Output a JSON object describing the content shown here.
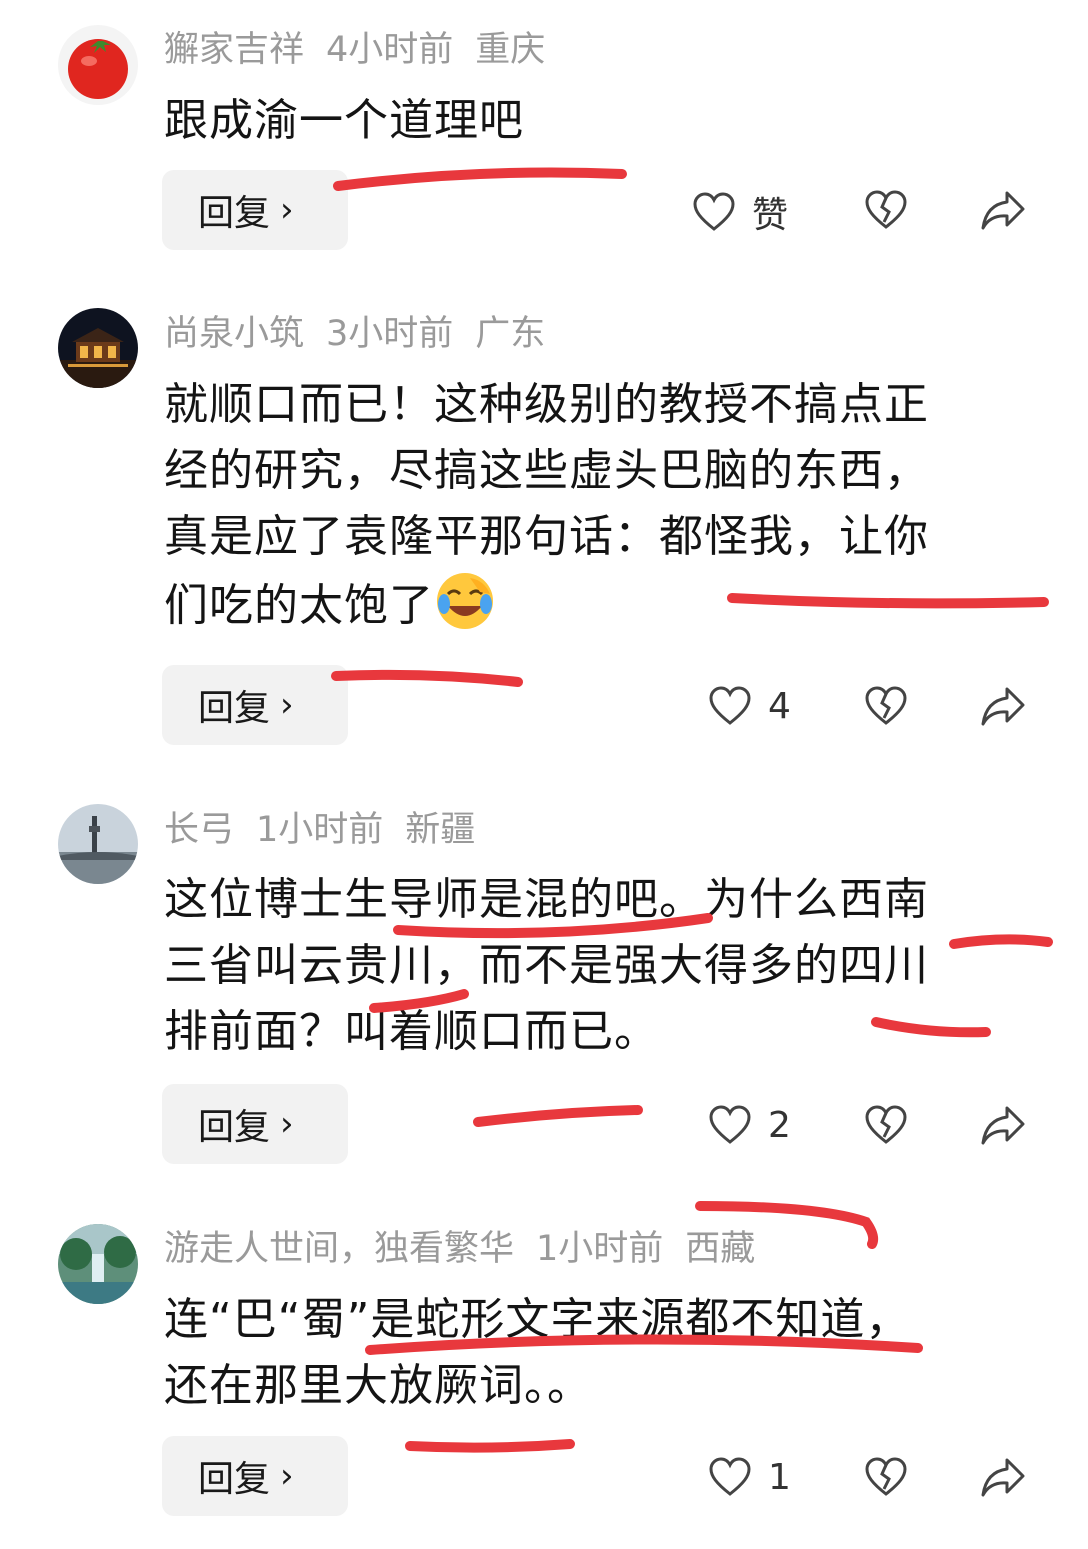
{
  "comments": [
    {
      "user": "獬家吉祥",
      "time": "4小时前",
      "location": "重庆",
      "text": "跟成渝一个道理吧",
      "reply_label": "回复",
      "likes": "赞"
    },
    {
      "user": "尚泉小筑",
      "time": "3小时前",
      "location": "广东",
      "text_lines": [
        "就顺口而已！这种级别的教授不搞点正",
        "经的研究，尽搞这些虚头巴脑的东西，",
        "真是应了袁隆平那句话：都怪我，让你",
        "们吃的太饱了"
      ],
      "reply_label": "回复",
      "likes": "4"
    },
    {
      "user": "长弓",
      "time": "1小时前",
      "location": "新疆",
      "text_lines": [
        "这位博士生导师是混的吧。为什么西南",
        "三省叫云贵川，而不是强大得多的四川",
        "排前面？叫着顺口而已。"
      ],
      "reply_label": "回复",
      "likes": "2"
    },
    {
      "user": "游走人世间，独看繁华",
      "time": "1小时前",
      "location": "西藏",
      "text_lines": [
        "连“巴“蜀”是蛇形文字来源都不知道，",
        "还在那里大放厥词。。"
      ],
      "reply_label": "回复",
      "likes": "1"
    }
  ],
  "colors": {
    "accent_marker": "#e8383d",
    "meta": "#9a9a9a",
    "reply_bg": "#f2f2f2"
  }
}
